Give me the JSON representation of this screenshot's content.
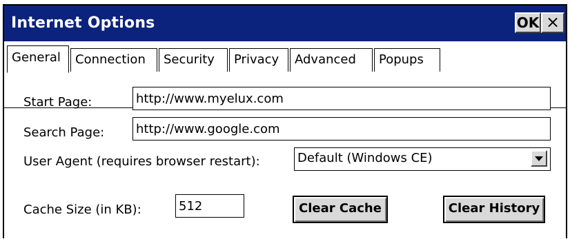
{
  "window": {
    "title": "Internet Options",
    "ok_label": "OK",
    "close_label": "×"
  },
  "colors": {
    "titlebar": "#0b237d",
    "button_face": "#d9d9d9"
  },
  "tabs": [
    {
      "label": "General",
      "active": true
    },
    {
      "label": "Connection",
      "active": false
    },
    {
      "label": "Security",
      "active": false
    },
    {
      "label": "Privacy",
      "active": false
    },
    {
      "label": "Advanced",
      "active": false
    },
    {
      "label": "Popups",
      "active": false
    }
  ],
  "general": {
    "start_page_label": "Start Page:",
    "start_page_value": "http://www.myelux.com",
    "search_page_label": "Search Page:",
    "search_page_value": "http://www.google.com",
    "user_agent_label": "User Agent (requires browser restart):",
    "user_agent_value": "Default (Windows CE)",
    "cache_size_label": "Cache Size (in KB):",
    "cache_size_value": "512",
    "clear_cache_label": "Clear Cache",
    "clear_history_label": "Clear History"
  }
}
